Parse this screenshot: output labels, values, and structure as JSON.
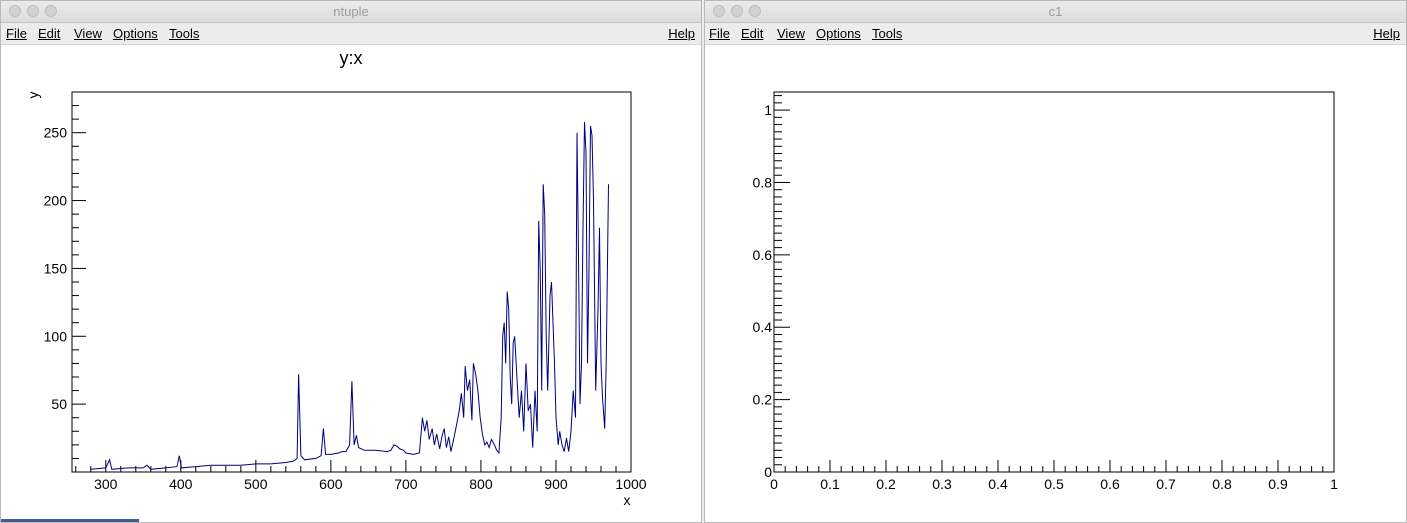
{
  "windows": [
    {
      "title": "ntuple",
      "menu": [
        "File",
        "Edit",
        "View",
        "Options",
        "Tools"
      ],
      "help": "Help"
    },
    {
      "title": "c1",
      "menu": [
        "File",
        "Edit",
        "View",
        "Options",
        "Tools"
      ],
      "help": "Help"
    }
  ],
  "chart_data": [
    {
      "type": "line",
      "title": "y:x",
      "xlabel": "x",
      "ylabel": "y",
      "xlim": [
        255,
        1000
      ],
      "ylim": [
        0,
        280
      ],
      "xticks": [
        300,
        400,
        500,
        600,
        700,
        800,
        900,
        1000
      ],
      "yticks": [
        50,
        100,
        150,
        200,
        250
      ],
      "line_color": "#00007f",
      "series": [
        {
          "points": [
            [
              280,
              2
            ],
            [
              300,
              3
            ],
            [
              305,
              9
            ],
            [
              308,
              2
            ],
            [
              330,
              3
            ],
            [
              350,
              3
            ],
            [
              355,
              5
            ],
            [
              360,
              2
            ],
            [
              380,
              3
            ],
            [
              395,
              4
            ],
            [
              398,
              12
            ],
            [
              401,
              3
            ],
            [
              420,
              4
            ],
            [
              440,
              5
            ],
            [
              460,
              5
            ],
            [
              480,
              5
            ],
            [
              500,
              6
            ],
            [
              520,
              6
            ],
            [
              540,
              7
            ],
            [
              550,
              8
            ],
            [
              555,
              10
            ],
            [
              557,
              72
            ],
            [
              560,
              12
            ],
            [
              565,
              9
            ],
            [
              580,
              10
            ],
            [
              587,
              12
            ],
            [
              590,
              32
            ],
            [
              593,
              13
            ],
            [
              600,
              13
            ],
            [
              610,
              14
            ],
            [
              615,
              15
            ],
            [
              620,
              15
            ],
            [
              625,
              20
            ],
            [
              628,
              67
            ],
            [
              631,
              20
            ],
            [
              634,
              27
            ],
            [
              637,
              18
            ],
            [
              645,
              16
            ],
            [
              660,
              16
            ],
            [
              675,
              15
            ],
            [
              680,
              16
            ],
            [
              684,
              20
            ],
            [
              688,
              19
            ],
            [
              692,
              17
            ],
            [
              697,
              16
            ],
            [
              700,
              14
            ],
            [
              710,
              13
            ],
            [
              718,
              14
            ],
            [
              722,
              40
            ],
            [
              725,
              30
            ],
            [
              728,
              38
            ],
            [
              731,
              24
            ],
            [
              735,
              32
            ],
            [
              738,
              20
            ],
            [
              741,
              28
            ],
            [
              745,
              17
            ],
            [
              748,
              26
            ],
            [
              751,
              32
            ],
            [
              754,
              18
            ],
            [
              757,
              26
            ],
            [
              760,
              15
            ],
            [
              764,
              25
            ],
            [
              768,
              36
            ],
            [
              771,
              45
            ],
            [
              774,
              58
            ],
            [
              777,
              40
            ],
            [
              779,
              78
            ],
            [
              782,
              60
            ],
            [
              785,
              68
            ],
            [
              788,
              38
            ],
            [
              790,
              80
            ],
            [
              793,
              72
            ],
            [
              796,
              60
            ],
            [
              799,
              40
            ],
            [
              802,
              28
            ],
            [
              805,
              20
            ],
            [
              808,
              22
            ],
            [
              811,
              18
            ],
            [
              814,
              24
            ],
            [
              818,
              20
            ],
            [
              821,
              16
            ],
            [
              824,
              14
            ],
            [
              827,
              40
            ],
            [
              829,
              100
            ],
            [
              831,
              110
            ],
            [
              833,
              80
            ],
            [
              835,
              133
            ],
            [
              837,
              120
            ],
            [
              839,
              70
            ],
            [
              841,
              50
            ],
            [
              843,
              95
            ],
            [
              845,
              100
            ],
            [
              848,
              70
            ],
            [
              851,
              40
            ],
            [
              854,
              60
            ],
            [
              857,
              30
            ],
            [
              860,
              80
            ],
            [
              863,
              45
            ],
            [
              866,
              50
            ],
            [
              869,
              18
            ],
            [
              872,
              60
            ],
            [
              875,
              30
            ],
            [
              877,
              185
            ],
            [
              879,
              150
            ],
            [
              881,
              60
            ],
            [
              883,
              212
            ],
            [
              885,
              190
            ],
            [
              887,
              100
            ],
            [
              889,
              60
            ],
            [
              892,
              130
            ],
            [
              894,
              140
            ],
            [
              896,
              110
            ],
            [
              898,
              80
            ],
            [
              900,
              40
            ],
            [
              903,
              20
            ],
            [
              905,
              30
            ],
            [
              908,
              20
            ],
            [
              911,
              15
            ],
            [
              914,
              25
            ],
            [
              917,
              15
            ],
            [
              920,
              30
            ],
            [
              923,
              60
            ],
            [
              926,
              40
            ],
            [
              928,
              250
            ],
            [
              930,
              160
            ],
            [
              932,
              50
            ],
            [
              934,
              80
            ],
            [
              936,
              180
            ],
            [
              938,
              258
            ],
            [
              940,
              235
            ],
            [
              942,
              80
            ],
            [
              944,
              150
            ],
            [
              946,
              255
            ],
            [
              948,
              248
            ],
            [
              950,
              200
            ],
            [
              953,
              60
            ],
            [
              956,
              120
            ],
            [
              958,
              180
            ],
            [
              960,
              80
            ],
            [
              962,
              55
            ],
            [
              965,
              32
            ],
            [
              967,
              80
            ],
            [
              970,
              212
            ]
          ]
        }
      ]
    },
    {
      "type": "line",
      "title": "",
      "xlabel": "",
      "ylabel": "",
      "xlim": [
        0,
        1
      ],
      "ylim": [
        0,
        1.05
      ],
      "xticks": [
        0,
        0.1,
        0.2,
        0.3,
        0.4,
        0.5,
        0.6,
        0.7,
        0.8,
        0.9,
        1
      ],
      "xtick_labels": [
        "0",
        "0.1",
        "0.2",
        "0.3",
        "0.4",
        "0.5",
        "0.6",
        "0.7",
        "0.8",
        "0.9",
        "1"
      ],
      "yticks": [
        0,
        0.2,
        0.4,
        0.6,
        0.8,
        1
      ],
      "ytick_labels": [
        "0",
        "0.2",
        "0.4",
        "0.6",
        "0.8",
        "1"
      ],
      "series": []
    }
  ]
}
